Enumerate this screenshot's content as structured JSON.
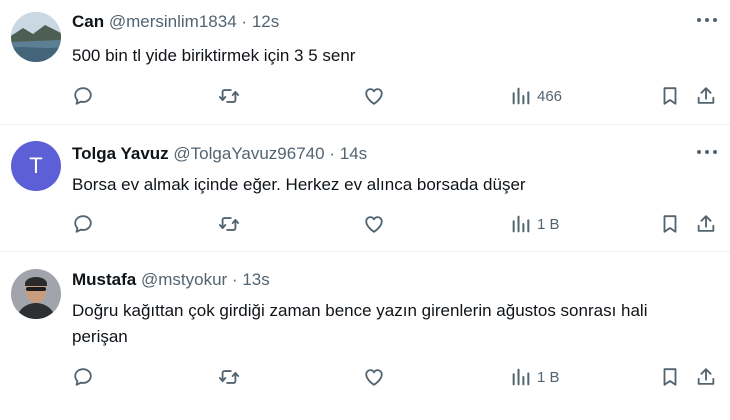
{
  "tweets": [
    {
      "name": "Can",
      "handle": "@mersinlim1834",
      "separator": "·",
      "time": "12s",
      "text": "500 bin tl yide biriktirmek için 3 5 senr",
      "views": "466"
    },
    {
      "name": "Tolga Yavuz",
      "handle": "@TolgaYavuz96740",
      "separator": "·",
      "time": "14s",
      "text": "Borsa ev almak içinde eğer. Herkez ev alınca borsada düşer",
      "views": "1 B",
      "avatar_initial": "T",
      "avatar_color": "#5c5fd6"
    },
    {
      "name": "Mustafa",
      "handle": "@mstyokur",
      "separator": "·",
      "time": "13s",
      "text": "Doğru kağıttan çok girdiği zaman bence yazın girenlerin ağustos sonrası hali perişan",
      "views": "1 B"
    }
  ],
  "icons": {
    "reply": "reply-icon",
    "retweet": "retweet-icon",
    "like": "like-icon",
    "views": "views-icon",
    "bookmark": "bookmark-icon",
    "share": "share-icon",
    "more": "more-icon"
  },
  "colors": {
    "text": "#0f1419",
    "secondary": "#536471",
    "divider": "#eff3f4"
  }
}
